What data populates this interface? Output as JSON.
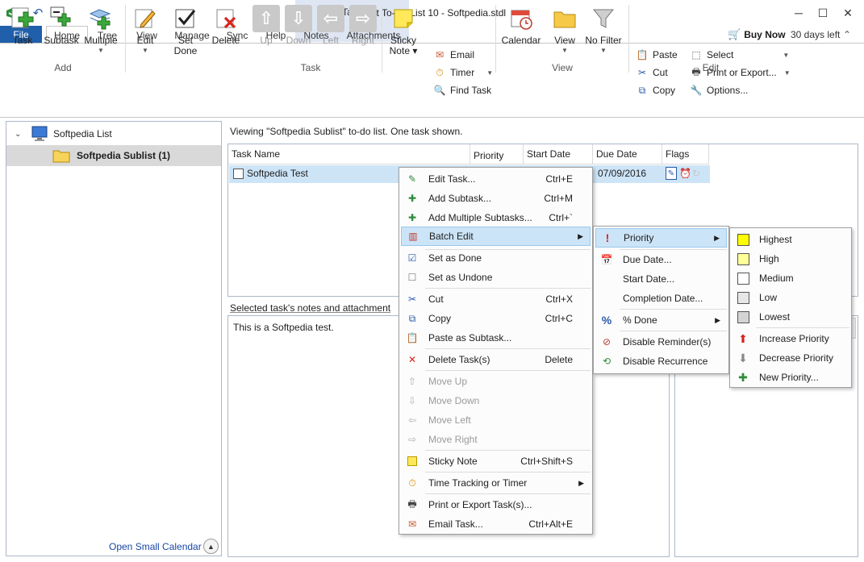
{
  "window": {
    "title": "Swift To-Do List 10 - Softpedia.stdl",
    "contextual_tab_group": "Task"
  },
  "ribbon_tabs": {
    "file": "File",
    "home": "Home",
    "tree": "Tree",
    "view": "View",
    "manage": "Manage",
    "sync": "Sync",
    "help": "Help",
    "notes": "Notes",
    "attachments": "Attachments"
  },
  "header_right": {
    "buy_now": "Buy Now",
    "days_left": "30 days left"
  },
  "ribbon": {
    "add_group": {
      "label": "Add",
      "task": "Task",
      "subtask": "Subtask",
      "multiple": "Multiple"
    },
    "task_group": {
      "label": "Task",
      "edit": "Edit",
      "set_done_1": "Set",
      "set_done_2": "Done",
      "delete": "Delete",
      "up": "Up",
      "down": "Down",
      "left": "Left",
      "right": "Right",
      "sticky_1": "Sticky",
      "sticky_2": "Note",
      "email": "Email",
      "timer": "Timer",
      "find_task": "Find Task"
    },
    "view_group": {
      "label": "View",
      "calendar": "Calendar",
      "view": "View",
      "no_filter": "No Filter"
    },
    "edit_group": {
      "label": "Edit",
      "paste": "Paste",
      "cut": "Cut",
      "copy": "Copy",
      "select": "Select",
      "print_export": "Print or Export...",
      "options": "Options..."
    }
  },
  "tree": {
    "root": "Softpedia List",
    "child": "Softpedia Sublist (1)",
    "open_calendar": "Open Small Calendar"
  },
  "main": {
    "viewing_text": "Viewing \"Softpedia Sublist\" to-do list. One task shown.",
    "columns": {
      "task_name": "Task Name",
      "priority": "Priority",
      "start_date": "Start Date",
      "due_date": "Due Date",
      "flags": "Flags"
    },
    "task": {
      "name": "Softpedia Test",
      "due_date": "07/09/2016"
    },
    "notes_label": "Selected task's notes and attachment",
    "notes_text": "This is a Softpedia test."
  },
  "context_menu": {
    "edit_task": "Edit Task...",
    "edit_task_sc": "Ctrl+E",
    "add_subtask": "Add Subtask...",
    "add_subtask_sc": "Ctrl+M",
    "add_multiple": "Add Multiple Subtasks...",
    "add_multiple_sc": "Ctrl+`",
    "batch_edit": "Batch Edit",
    "set_done": "Set as Done",
    "set_undone": "Set as Undone",
    "cut": "Cut",
    "cut_sc": "Ctrl+X",
    "copy": "Copy",
    "copy_sc": "Ctrl+C",
    "paste_subtask": "Paste as Subtask...",
    "delete_task": "Delete Task(s)",
    "delete_sc": "Delete",
    "move_up": "Move Up",
    "move_down": "Move Down",
    "move_left": "Move Left",
    "move_right": "Move Right",
    "sticky_note": "Sticky Note",
    "sticky_sc": "Ctrl+Shift+S",
    "time_tracking": "Time Tracking or Timer",
    "print_export": "Print or Export Task(s)...",
    "email_task": "Email Task...",
    "email_sc": "Ctrl+Alt+E"
  },
  "batch_menu": {
    "priority": "Priority",
    "due_date": "Due Date...",
    "start_date": "Start Date...",
    "completion_date": "Completion Date...",
    "percent_done": "% Done",
    "disable_reminders": "Disable Reminder(s)",
    "disable_recurrence": "Disable Recurrence"
  },
  "priority_menu": {
    "highest": "Highest",
    "high": "High",
    "medium": "Medium",
    "low": "Low",
    "lowest": "Lowest",
    "increase": "Increase Priority",
    "decrease": "Decrease Priority",
    "new": "New Priority..."
  },
  "colors": {
    "file_tab": "#1f5fab",
    "highlight": "#cce4f7",
    "highest": "#ffff00",
    "high": "#ffff99",
    "medium": "#ffffff",
    "low": "#e6e6e6",
    "lowest": "#d4d4d4"
  }
}
